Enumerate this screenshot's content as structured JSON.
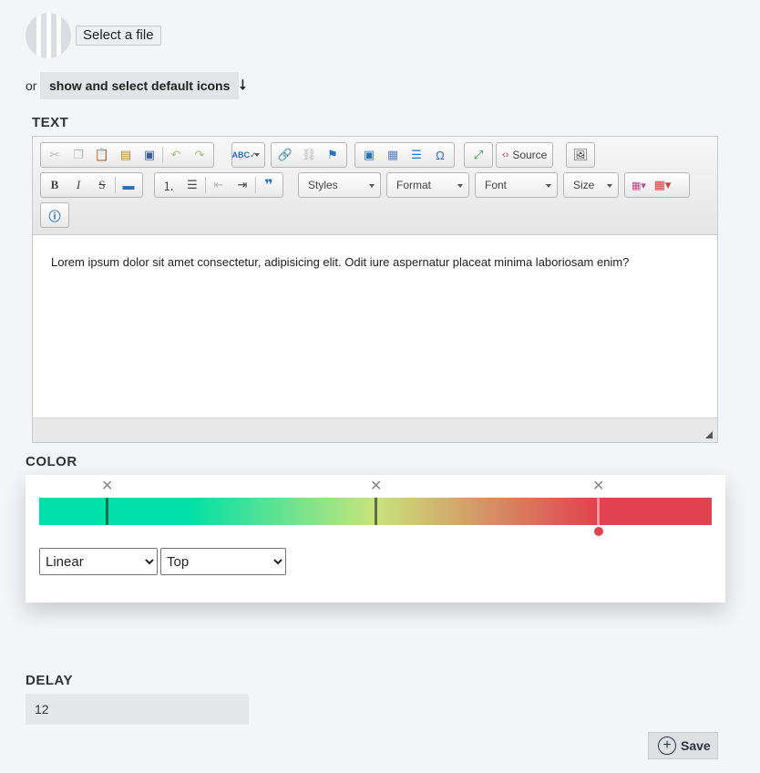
{
  "file": {
    "select_label": "Select a file"
  },
  "icons": {
    "or_text": "or",
    "default_icons_label": "show and select default icons",
    "arrow": "⭣"
  },
  "text_section": {
    "label": "TEXT",
    "toolbar": {
      "source_label": "Source",
      "combos": {
        "styles": "Styles",
        "format": "Format",
        "font": "Font",
        "size": "Size"
      }
    },
    "content": "Lorem ipsum dolor sit amet consectetur, adipisicing elit. Odit iure aspernatur placeat minima laboriosam enim?"
  },
  "color_section": {
    "label": "COLOR",
    "gradient_colors": [
      "#00e0a8",
      "#c8e47c",
      "#e2414f"
    ],
    "stops": [
      0.1,
      0.5,
      0.83
    ],
    "selected_stop_color": "#e2414f",
    "type": {
      "selected": "Linear",
      "options": [
        "Linear"
      ]
    },
    "direction": {
      "selected": "Top",
      "options": [
        "Top"
      ]
    }
  },
  "delay_section": {
    "label": "DELAY",
    "value": "12"
  },
  "save": {
    "label": "Save",
    "icon": "plus-circle-icon"
  }
}
